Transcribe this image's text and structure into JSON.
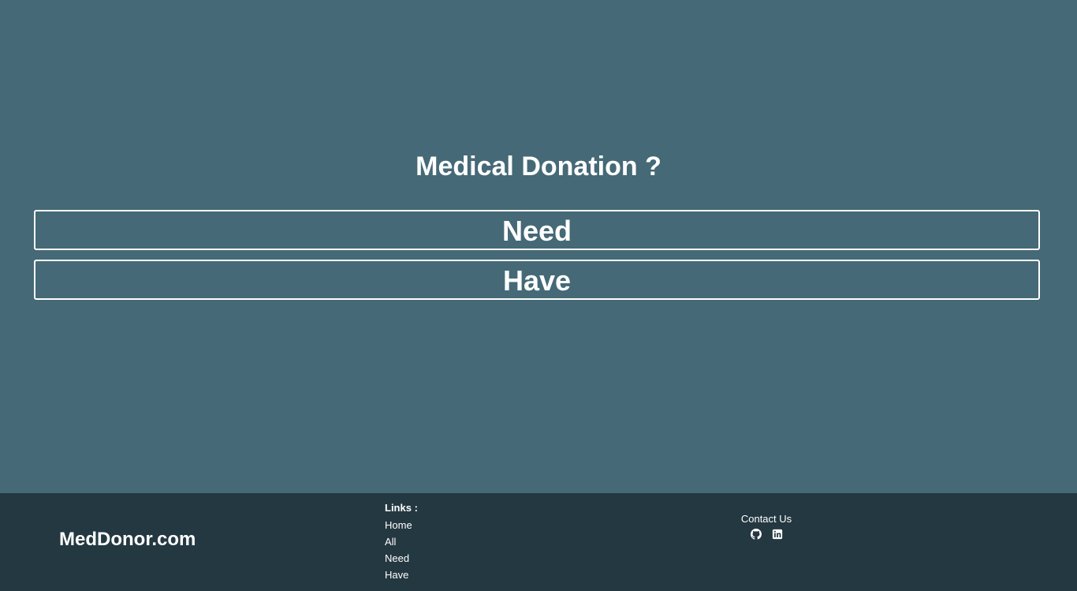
{
  "main": {
    "question": "Medical Donation ?",
    "options": {
      "need": "Need",
      "have": "Have"
    }
  },
  "footer": {
    "brand": "MedDonor.com",
    "links_heading": "Links :",
    "links": [
      "Home",
      "All",
      "Need",
      "Have"
    ],
    "contact_label": "Contact Us",
    "social_icons": [
      "github-icon",
      "linkedin-icon"
    ]
  },
  "colors": {
    "background": "#456976",
    "footer_background": "#243841",
    "text": "#ffffff"
  }
}
